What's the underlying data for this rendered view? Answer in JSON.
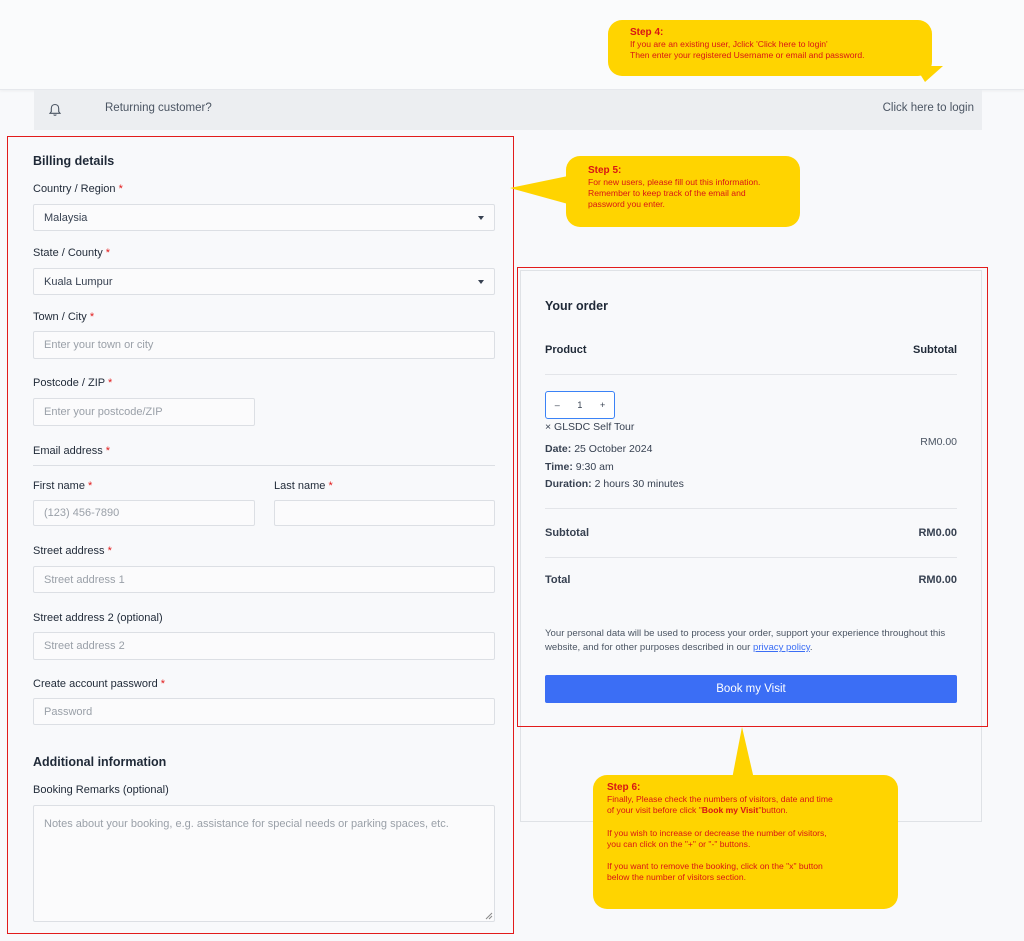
{
  "notice": {
    "question": "Returning customer?",
    "login_link": "Click here to login"
  },
  "billing": {
    "title": "Billing details",
    "country_label": "Country / Region",
    "country_value": "Malaysia",
    "state_label": "State / County",
    "state_value": "Kuala Lumpur",
    "town_label": "Town / City",
    "town_placeholder": "Enter your town or city",
    "postcode_label": "Postcode / ZIP",
    "postcode_placeholder": "Enter your postcode/ZIP",
    "email_label": "Email address",
    "first_name_label": "First name",
    "first_name_placeholder": "(123) 456-7890",
    "last_name_label": "Last name",
    "street_label": "Street address",
    "street_placeholder": "Street address 1",
    "street2_label": "Street address 2 (optional)",
    "street2_placeholder": "Street address 2",
    "password_label": "Create account password",
    "password_placeholder": "Password",
    "required_mark": "*"
  },
  "additional": {
    "title": "Additional information",
    "remarks_label": "Booking Remarks (optional)",
    "remarks_placeholder": "Notes about your booking, e.g. assistance for special needs or parking spaces, etc."
  },
  "order": {
    "title": "Your order",
    "col_product": "Product",
    "col_subtotal": "Subtotal",
    "qty_minus": "–",
    "qty_value": "1",
    "qty_plus": "+",
    "product_name": "× GLSDC Self Tour",
    "date_label": "Date:",
    "date_value": "25 October 2024",
    "time_label": "Time:",
    "time_value": "9:30 am",
    "duration_label": "Duration:",
    "duration_value": "2 hours 30 minutes",
    "item_price": "RM0.00",
    "subtotal_label": "Subtotal",
    "subtotal_value": "RM0.00",
    "total_label": "Total",
    "total_value": "RM0.00",
    "privacy_text": "Your personal data will be used to process your order, support your experience throughout this website, and for other purposes described in our",
    "privacy_link": "privacy policy",
    "privacy_end": ".",
    "book_button": "Book my Visit"
  },
  "callouts": {
    "step4_title": "Step 4:",
    "step4_line1": "If you are an existing user, Jclick 'Click here to login'",
    "step4_line2": "Then enter your registered Username or email and password.",
    "step5_title": "Step 5:",
    "step5_line1": "For new users, please fill out this information.",
    "step5_line2": "Remember to keep track of the email and",
    "step5_line3": "password you enter.",
    "step6_title": "Step 6:",
    "step6_line1": "Finally, Please check the numbers of visitors, date and time",
    "step6_line2a": "of your visit before click \"",
    "step6_line2b": "Book my Visit",
    "step6_line2c": "\"button.",
    "step6_line3": "If you wish to increase or decrease the number of visitors,",
    "step6_line4": "you can click on the \"+\" or \"-\" buttons.",
    "step6_line5": "If you want to remove the booking, click on the \"x\" button",
    "step6_line6": "below the number of visitors section."
  },
  "colors": {
    "accent": "#3b6ef5",
    "highlight": "#e21b1b",
    "callout_bg": "#ffd400",
    "callout_text": "#d81515"
  },
  "icons": {
    "notice": "bell-icon",
    "select": "chevron-down-icon"
  }
}
